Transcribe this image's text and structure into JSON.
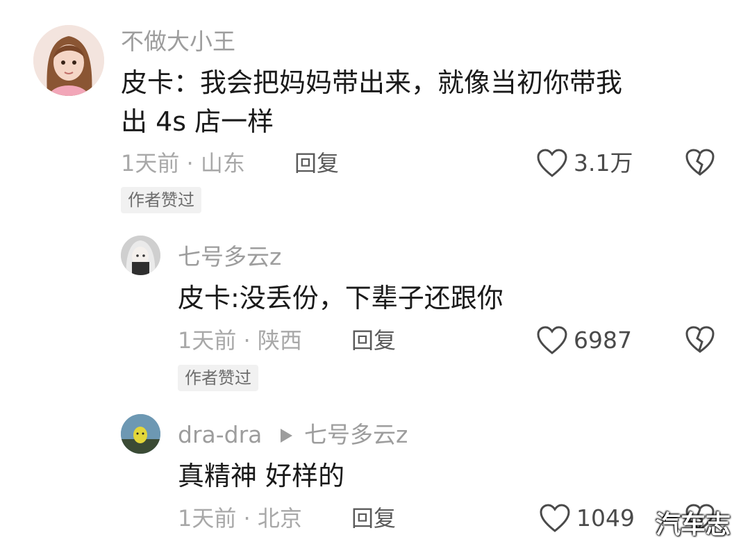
{
  "comments": [
    {
      "username": "不做大小王",
      "text_line1": "皮卡：我会把妈妈带出来，就像当初你带我",
      "text_line2": "出 4s 店一样",
      "meta": "1天前 · 山东",
      "reply": "回复",
      "likes": "3.1万",
      "tag": "作者赞过"
    },
    {
      "username": "七号多云z",
      "text": "皮卡:没丢份，下辈子还跟你",
      "meta": "1天前 · 陕西",
      "reply": "回复",
      "likes": "6987",
      "tag": "作者赞过"
    },
    {
      "username": "dra-dra",
      "reply_to": "七号多云z",
      "text": "真精神 好样的",
      "meta": "1天前 · 北京",
      "reply": "回复",
      "likes": "1049"
    }
  ],
  "watermark": "汽车志"
}
